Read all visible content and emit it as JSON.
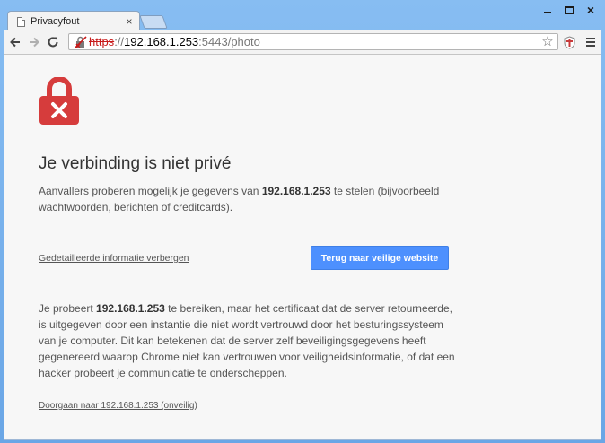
{
  "tab": {
    "title": "Privacyfout",
    "close": "×"
  },
  "window_controls": {
    "minimize": "minimize-icon",
    "maximize": "maximize-icon",
    "close": "×"
  },
  "toolbar": {
    "url_scheme": "https",
    "url_sep": "://",
    "url_host": "192.168.1.253",
    "url_rest": ":5443/photo",
    "star": "☆"
  },
  "page": {
    "headline": "Je verbinding is niet privé",
    "p1_before": "Aanvallers proberen mogelijk je gegevens van ",
    "p1_host": "192.168.1.253",
    "p1_after": " te stelen (bijvoorbeeld wachtwoorden, berichten of creditcards).",
    "details_link": "Gedetailleerde informatie verbergen",
    "safe_button": "Terug naar veilige website",
    "p2_before": "Je probeert ",
    "p2_host": "192.168.1.253",
    "p2_after": " te bereiken, maar het certificaat dat de server retourneerde, is uitgegeven door een instantie die niet wordt vertrouwd door het besturingssysteem van je computer. Dit kan betekenen dat de server zelf beveiligingsgegevens heeft gegenereerd waarop Chrome niet kan vertrouwen voor veiligheidsinformatie, of dat een hacker probeert je communicatie te onderscheppen.",
    "proceed_link": "Doorgaan naar 192.168.1.253 (onveilig)"
  },
  "colors": {
    "accent_button": "#4d90fe",
    "error_red": "#d63c3c",
    "url_scheme_red": "#c81b1b"
  }
}
